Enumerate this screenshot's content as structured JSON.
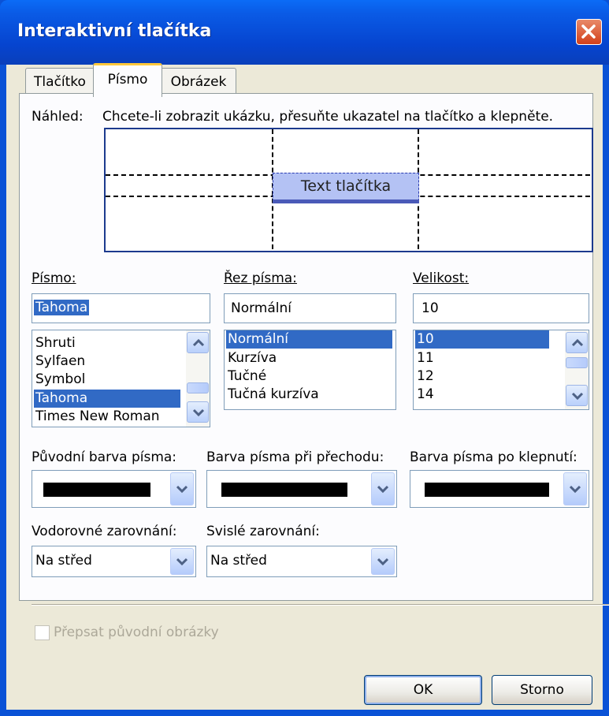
{
  "window": {
    "title": "Interaktivní tlačítka"
  },
  "tabs": [
    {
      "label": "Tlačítko"
    },
    {
      "label": "Písmo"
    },
    {
      "label": "Obrázek"
    }
  ],
  "preview": {
    "label": "Náhled:",
    "hint": "Chcete-li zobrazit ukázku, přesuňte ukazatel na tlačítko a klepněte.",
    "sample_text": "Text tlačítka"
  },
  "font": {
    "label": "Písmo:",
    "value": "Tahoma",
    "items": [
      "Shruti",
      "Sylfaen",
      "Symbol",
      "Tahoma",
      "Times New Roman"
    ],
    "selected": "Tahoma"
  },
  "style": {
    "label": "Řez písma:",
    "value": "Normální",
    "items": [
      "Normální",
      "Kurzíva",
      "Tučné",
      "Tučná kurzíva"
    ],
    "selected": "Normální"
  },
  "size": {
    "label": "Velikost:",
    "value": "10",
    "items": [
      "10",
      "11",
      "12",
      "14"
    ],
    "selected": "10"
  },
  "colors": {
    "original_label": "Původní barva písma:",
    "hover_label": "Barva písma při přechodu:",
    "click_label": "Barva písma po klepnutí:",
    "original": "#000000",
    "hover": "#000000",
    "click": "#000000"
  },
  "alignment": {
    "horizontal_label": "Vodorovné zarovnání:",
    "horizontal_value": "Na střed",
    "vertical_label": "Svislé zarovnání:",
    "vertical_value": "Na střed"
  },
  "overwrite": {
    "label": "Přepsat původní obrázky",
    "checked": false,
    "enabled": false
  },
  "buttons": {
    "ok": "OK",
    "cancel": "Storno"
  }
}
